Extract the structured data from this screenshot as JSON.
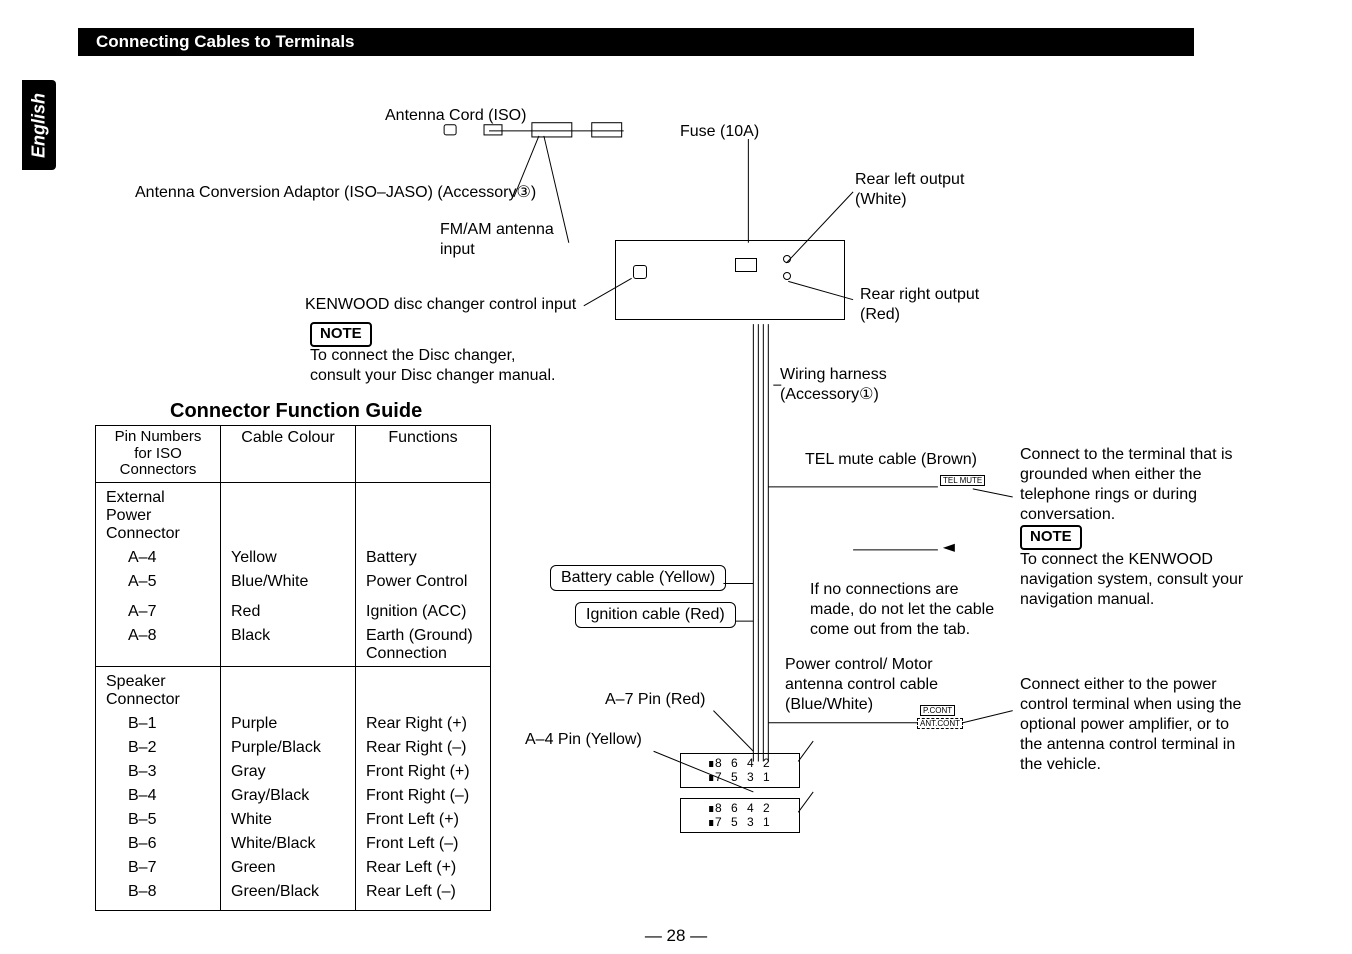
{
  "header": {
    "title": "Connecting Cables to Terminals"
  },
  "lang": "English",
  "page_number": "— 28 —",
  "labels": {
    "antenna_cord": "Antenna Cord (ISO)",
    "antenna_adaptor": "Antenna Conversion Adaptor (ISO–JASO) (Accessory③)",
    "fm_am": "FM/AM antenna input",
    "disc_changer": "KENWOOD disc changer control input",
    "disc_note_label": "NOTE",
    "disc_note_text": "To connect the Disc changer, consult your Disc changer manual.",
    "fuse": "Fuse (10A)",
    "rear_left": "Rear left output (White)",
    "rear_right": "Rear right output (Red)",
    "wiring_harness": "Wiring harness (Accessory①)",
    "tel_mute": "TEL mute cable (Brown)",
    "tel_mute_tag": "TEL MUTE",
    "tel_mute_desc": "Connect to the terminal that is grounded when either the telephone rings or during conversation.",
    "nav_note_label": "NOTE",
    "nav_note_text": "To connect the KENWOOD navigation system, consult your navigation manual.",
    "no_conn": "If no connections are made, do not let the cable come out from the tab.",
    "battery_cable": "Battery cable (Yellow)",
    "ignition_cable": "Ignition cable (Red)",
    "a7_pin": "A–7 Pin (Red)",
    "a4_pin": "A–4 Pin (Yellow)",
    "power_ctrl": "Power control/ Motor antenna control cable (Blue/White)",
    "pcont_tag": "P.CONT",
    "antcont_tag": "ANT.CONT",
    "power_ctrl_desc": "Connect either to the power control terminal when using the optional power amplifier, or to the antenna control terminal in the vehicle.",
    "pin_row_a": "8  6  4  2",
    "pin_row_b": "7  5  3  1"
  },
  "connector_guide": {
    "title": "Connector Function Guide",
    "headers": {
      "pin": "Pin Numbers for ISO Connectors",
      "color": "Cable Colour",
      "func": "Functions"
    },
    "ext_power_label": "External Power Connector",
    "speaker_label": "Speaker Connector",
    "rows_a": [
      {
        "pin": "A–4",
        "color": "Yellow",
        "func": "Battery"
      },
      {
        "pin": "A–5",
        "color": "Blue/White",
        "func": "Power Control"
      },
      {
        "pin": "A–7",
        "color": "Red",
        "func": "Ignition (ACC)"
      },
      {
        "pin": "A–8",
        "color": "Black",
        "func": "Earth (Ground) Connection"
      }
    ],
    "rows_b": [
      {
        "pin": "B–1",
        "color": "Purple",
        "func": "Rear Right (+)"
      },
      {
        "pin": "B–2",
        "color": "Purple/Black",
        "func": "Rear Right (–)"
      },
      {
        "pin": "B–3",
        "color": "Gray",
        "func": "Front Right (+)"
      },
      {
        "pin": "B–4",
        "color": "Gray/Black",
        "func": "Front Right (–)"
      },
      {
        "pin": "B–5",
        "color": "White",
        "func": "Front Left (+)"
      },
      {
        "pin": "B–6",
        "color": "White/Black",
        "func": "Front Left (–)"
      },
      {
        "pin": "B–7",
        "color": "Green",
        "func": "Rear Left (+)"
      },
      {
        "pin": "B–8",
        "color": "Green/Black",
        "func": "Rear Left (–)"
      }
    ]
  }
}
